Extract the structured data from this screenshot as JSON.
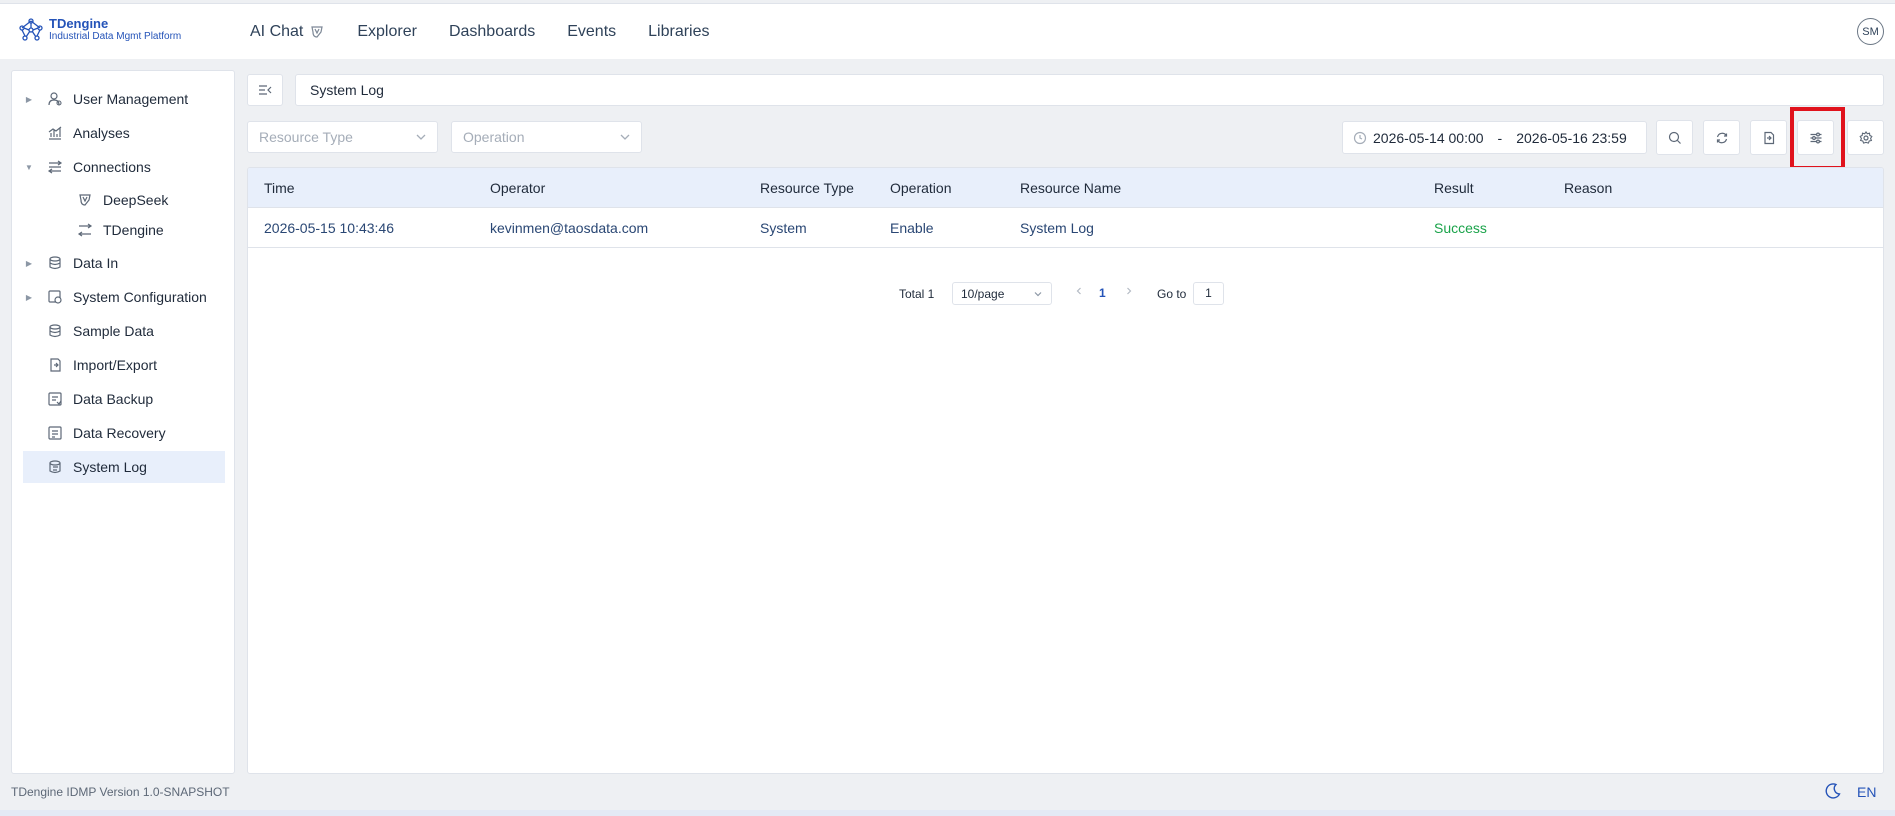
{
  "header": {
    "logo_title": "TDengine",
    "logo_subtitle": "Industrial Data Mgmt Platform",
    "nav": [
      "AI Chat",
      "Explorer",
      "Dashboards",
      "Events",
      "Libraries"
    ],
    "avatar": "SM"
  },
  "sidebar": {
    "items": [
      {
        "label": "User Management",
        "icon": "user-icon",
        "caret": "collapsed"
      },
      {
        "label": "Analyses",
        "icon": "chart-icon"
      },
      {
        "label": "Connections",
        "icon": "connections-icon",
        "caret": "expanded"
      },
      {
        "label": "DeepSeek",
        "icon": "deepseek-icon",
        "child": true
      },
      {
        "label": "TDengine",
        "icon": "tdengine-icon",
        "child": true
      },
      {
        "label": "Data In",
        "icon": "database-icon",
        "caret": "collapsed"
      },
      {
        "label": "System Configuration",
        "icon": "config-icon",
        "caret": "collapsed"
      },
      {
        "label": "Sample Data",
        "icon": "sample-data-icon"
      },
      {
        "label": "Import/Export",
        "icon": "import-export-icon"
      },
      {
        "label": "Data Backup",
        "icon": "backup-icon"
      },
      {
        "label": "Data Recovery",
        "icon": "recovery-icon"
      },
      {
        "label": "System Log",
        "icon": "log-icon",
        "active": true
      }
    ]
  },
  "page": {
    "title": "System Log",
    "filters": {
      "resource_type_placeholder": "Resource Type",
      "operation_placeholder": "Operation",
      "date_start": "2026-05-14 00:00",
      "date_sep": "-",
      "date_end": "2026-05-16 23:59"
    },
    "table": {
      "columns": [
        "Time",
        "Operator",
        "Resource Type",
        "Operation",
        "Resource Name",
        "Result",
        "Reason"
      ],
      "rows": [
        [
          "2026-05-15 10:43:46",
          "kevinmen@taosdata.com",
          "System",
          "Enable",
          "System Log",
          "Success",
          ""
        ]
      ]
    },
    "pagination": {
      "total": "Total 1",
      "page_size": "10/page",
      "current_page": "1",
      "goto_label": "Go to",
      "goto_value": "1"
    }
  },
  "footer": {
    "version": "TDengine IDMP Version 1.0-SNAPSHOT",
    "language": "EN"
  },
  "colors": {
    "accent": "#2453b8",
    "success": "#1aa34a",
    "highlight": "#e0121c",
    "header_row": "#e8effb"
  }
}
